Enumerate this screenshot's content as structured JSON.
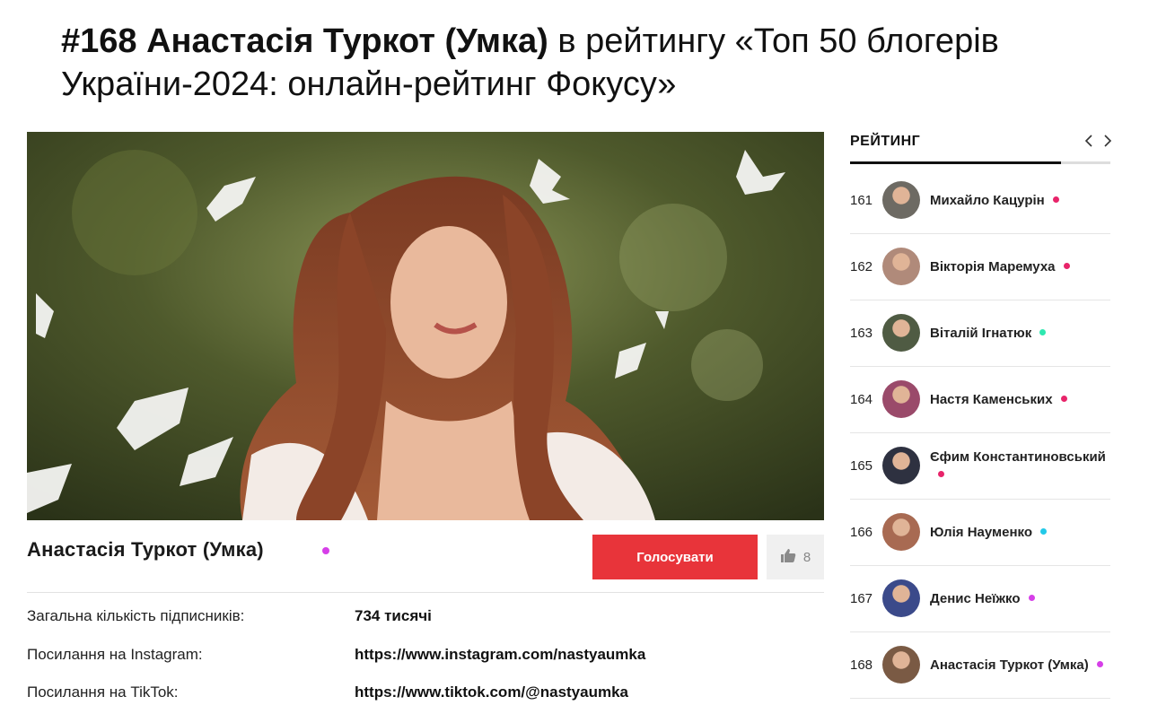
{
  "heading": {
    "bold": "#168 Анастасія Туркот (Умка)",
    "rest": " в рейтингу «Топ 50 блогерів України-2024: онлайн-рейтинг Фокусу»"
  },
  "profile": {
    "name": "Анастасія Туркот (Умка)",
    "dot_color": "#d63fe8",
    "vote_label": "Голосувати",
    "likes": "8",
    "info": [
      {
        "label": "Загальна кількість підписників:",
        "value": "734 тисячі"
      },
      {
        "label": "Посилання на Instagram:",
        "value": "https://www.instagram.com/nastyaumka"
      },
      {
        "label": "Посилання на TikTok:",
        "value": "https://www.tiktok.com/@nastyaumka"
      }
    ]
  },
  "sidebar": {
    "title": "РЕЙТИНГ",
    "progress": 0.81,
    "items": [
      {
        "rank": "161",
        "name": "Михайло Кацурін",
        "dot": "#e8246a",
        "avatar": "#6d6a63"
      },
      {
        "rank": "162",
        "name": "Вікторія Маремуха",
        "dot": "#e8246a",
        "avatar": "#b08a7a"
      },
      {
        "rank": "163",
        "name": "Віталій Ігнатюк",
        "dot": "#2ee8b0",
        "avatar": "#4f5b43"
      },
      {
        "rank": "164",
        "name": "Настя Каменських",
        "dot": "#e8246a",
        "avatar": "#9a4a6a"
      },
      {
        "rank": "165",
        "name": "Єфим Константиновський",
        "dot": "#e8246a",
        "avatar": "#2e3140"
      },
      {
        "rank": "166",
        "name": "Юлія Науменко",
        "dot": "#22c9e8",
        "avatar": "#a86a52"
      },
      {
        "rank": "167",
        "name": "Денис Неїжко",
        "dot": "#d63fe8",
        "avatar": "#3b4a8a"
      },
      {
        "rank": "168",
        "name": "Анастасія Туркот (Умка)",
        "dot": "#d63fe8",
        "avatar": "#7a5a44"
      }
    ]
  },
  "icons": {
    "like": "thumbs-up-icon",
    "prev": "chevron-left-icon",
    "next": "chevron-right-icon"
  }
}
